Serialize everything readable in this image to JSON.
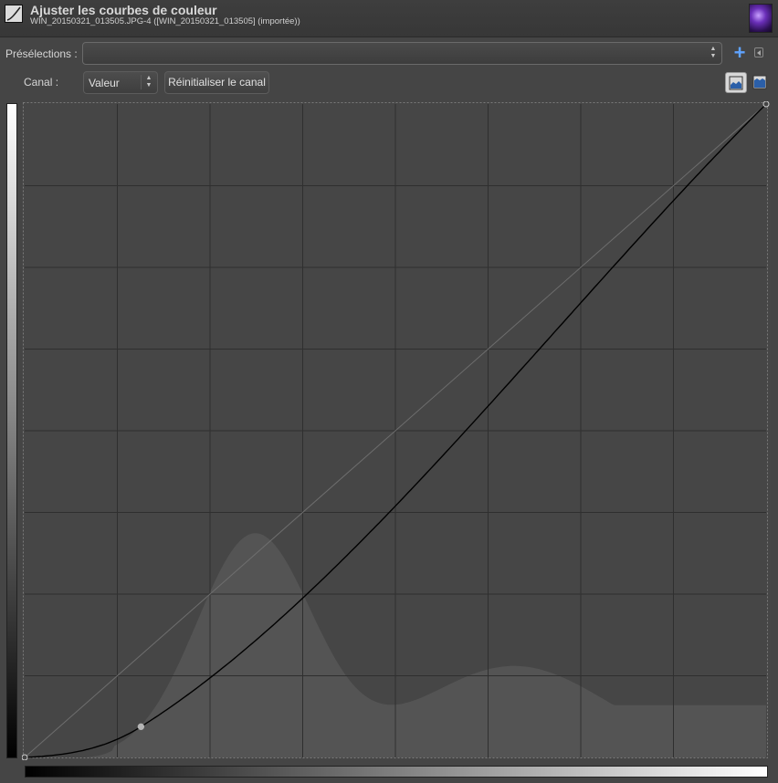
{
  "window": {
    "title": "Ajuster les courbes de couleur",
    "subtitle": "WIN_20150321_013505.JPG-4 ([WIN_20150321_013505] (importée))",
    "thumbnail_icon": "image-thumbnail"
  },
  "presets": {
    "label": "Présélections :",
    "selected": "",
    "add_icon": "plus-icon",
    "menu_icon": "preset-menu-icon"
  },
  "channel": {
    "label": "Canal :",
    "selected": "Valeur",
    "reset_label": "Réinitialiser le canal",
    "histogram_modes": [
      "linear-histogram-icon",
      "logarithmic-histogram-icon"
    ],
    "active_histogram_mode": "linear"
  },
  "curve": {
    "input_range": [
      0,
      255
    ],
    "output_range": [
      0,
      255
    ],
    "grid_divisions": 8,
    "control_points": [
      {
        "in": 0,
        "out": 0
      },
      {
        "in": 40,
        "out": 12
      },
      {
        "in": 255,
        "out": 255
      }
    ],
    "curve_color": "#000000",
    "histogram_color": "#5a5a5a",
    "background_color": "#464646"
  }
}
